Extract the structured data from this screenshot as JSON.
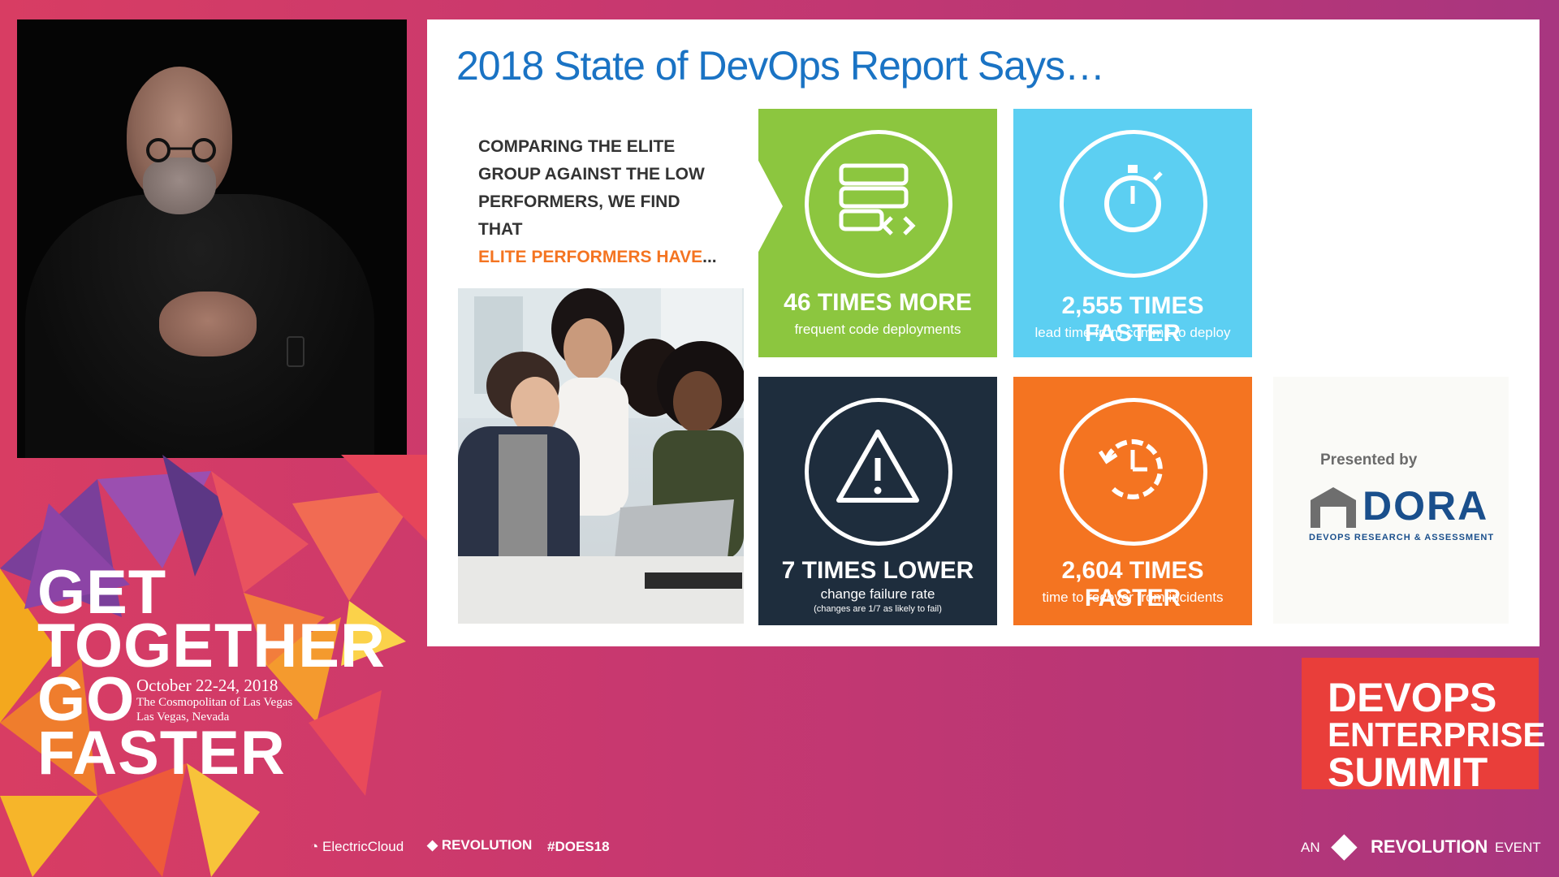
{
  "slide": {
    "title": "2018 State of DevOps Report Says…",
    "intro_line1": "COMPARING THE ELITE",
    "intro_line2": "GROUP AGAINST THE LOW",
    "intro_line3": "PERFORMERS, WE FIND THAT",
    "intro_highlight": "ELITE PERFORMERS HAVE",
    "intro_ellipsis": "...",
    "tiles": [
      {
        "big": "46 TIMES MORE",
        "small": "frequent code deployments",
        "color": "#8cc63f",
        "icon": "server-code-icon"
      },
      {
        "big": "2,555 TIMES FASTER",
        "small": "lead time from commit to deploy",
        "color": "#5ccff2",
        "icon": "stopwatch-icon"
      },
      {
        "big": "7 TIMES LOWER",
        "small": "change failure rate",
        "tiny": "(changes are 1/7 as likely to fail)",
        "color": "#1e2d3d",
        "icon": "warning-icon"
      },
      {
        "big": "2,604 TIMES FASTER",
        "small": "time to recover from incidents",
        "color": "#f47421",
        "icon": "clock-recover-icon"
      }
    ],
    "presented_by": "Presented by",
    "dora_name": "DORA",
    "dora_sub": "DEVOPS RESEARCH & ASSESSMENT"
  },
  "event": {
    "title_lines": [
      "GET",
      "TOGETHER",
      "GO",
      "FASTER"
    ],
    "date": "October 22-24, 2018",
    "venue": "The Cosmopolitan of Las Vegas",
    "city": "Las Vegas, Nevada"
  },
  "summit": {
    "line1": "DEVOPS",
    "line2": "ENTERPRISE",
    "line3": "SUMMIT"
  },
  "footer": {
    "sponsor1": "ElectricCloud",
    "sponsor2": "REVOLUTION",
    "hashtag": "#DOES18",
    "an": "AN",
    "revolution": "REVOLUTION",
    "event": "EVENT"
  },
  "colors": {
    "accent": "#e93e3a",
    "title_blue": "#1a73c4",
    "highlight_orange": "#f47421"
  }
}
